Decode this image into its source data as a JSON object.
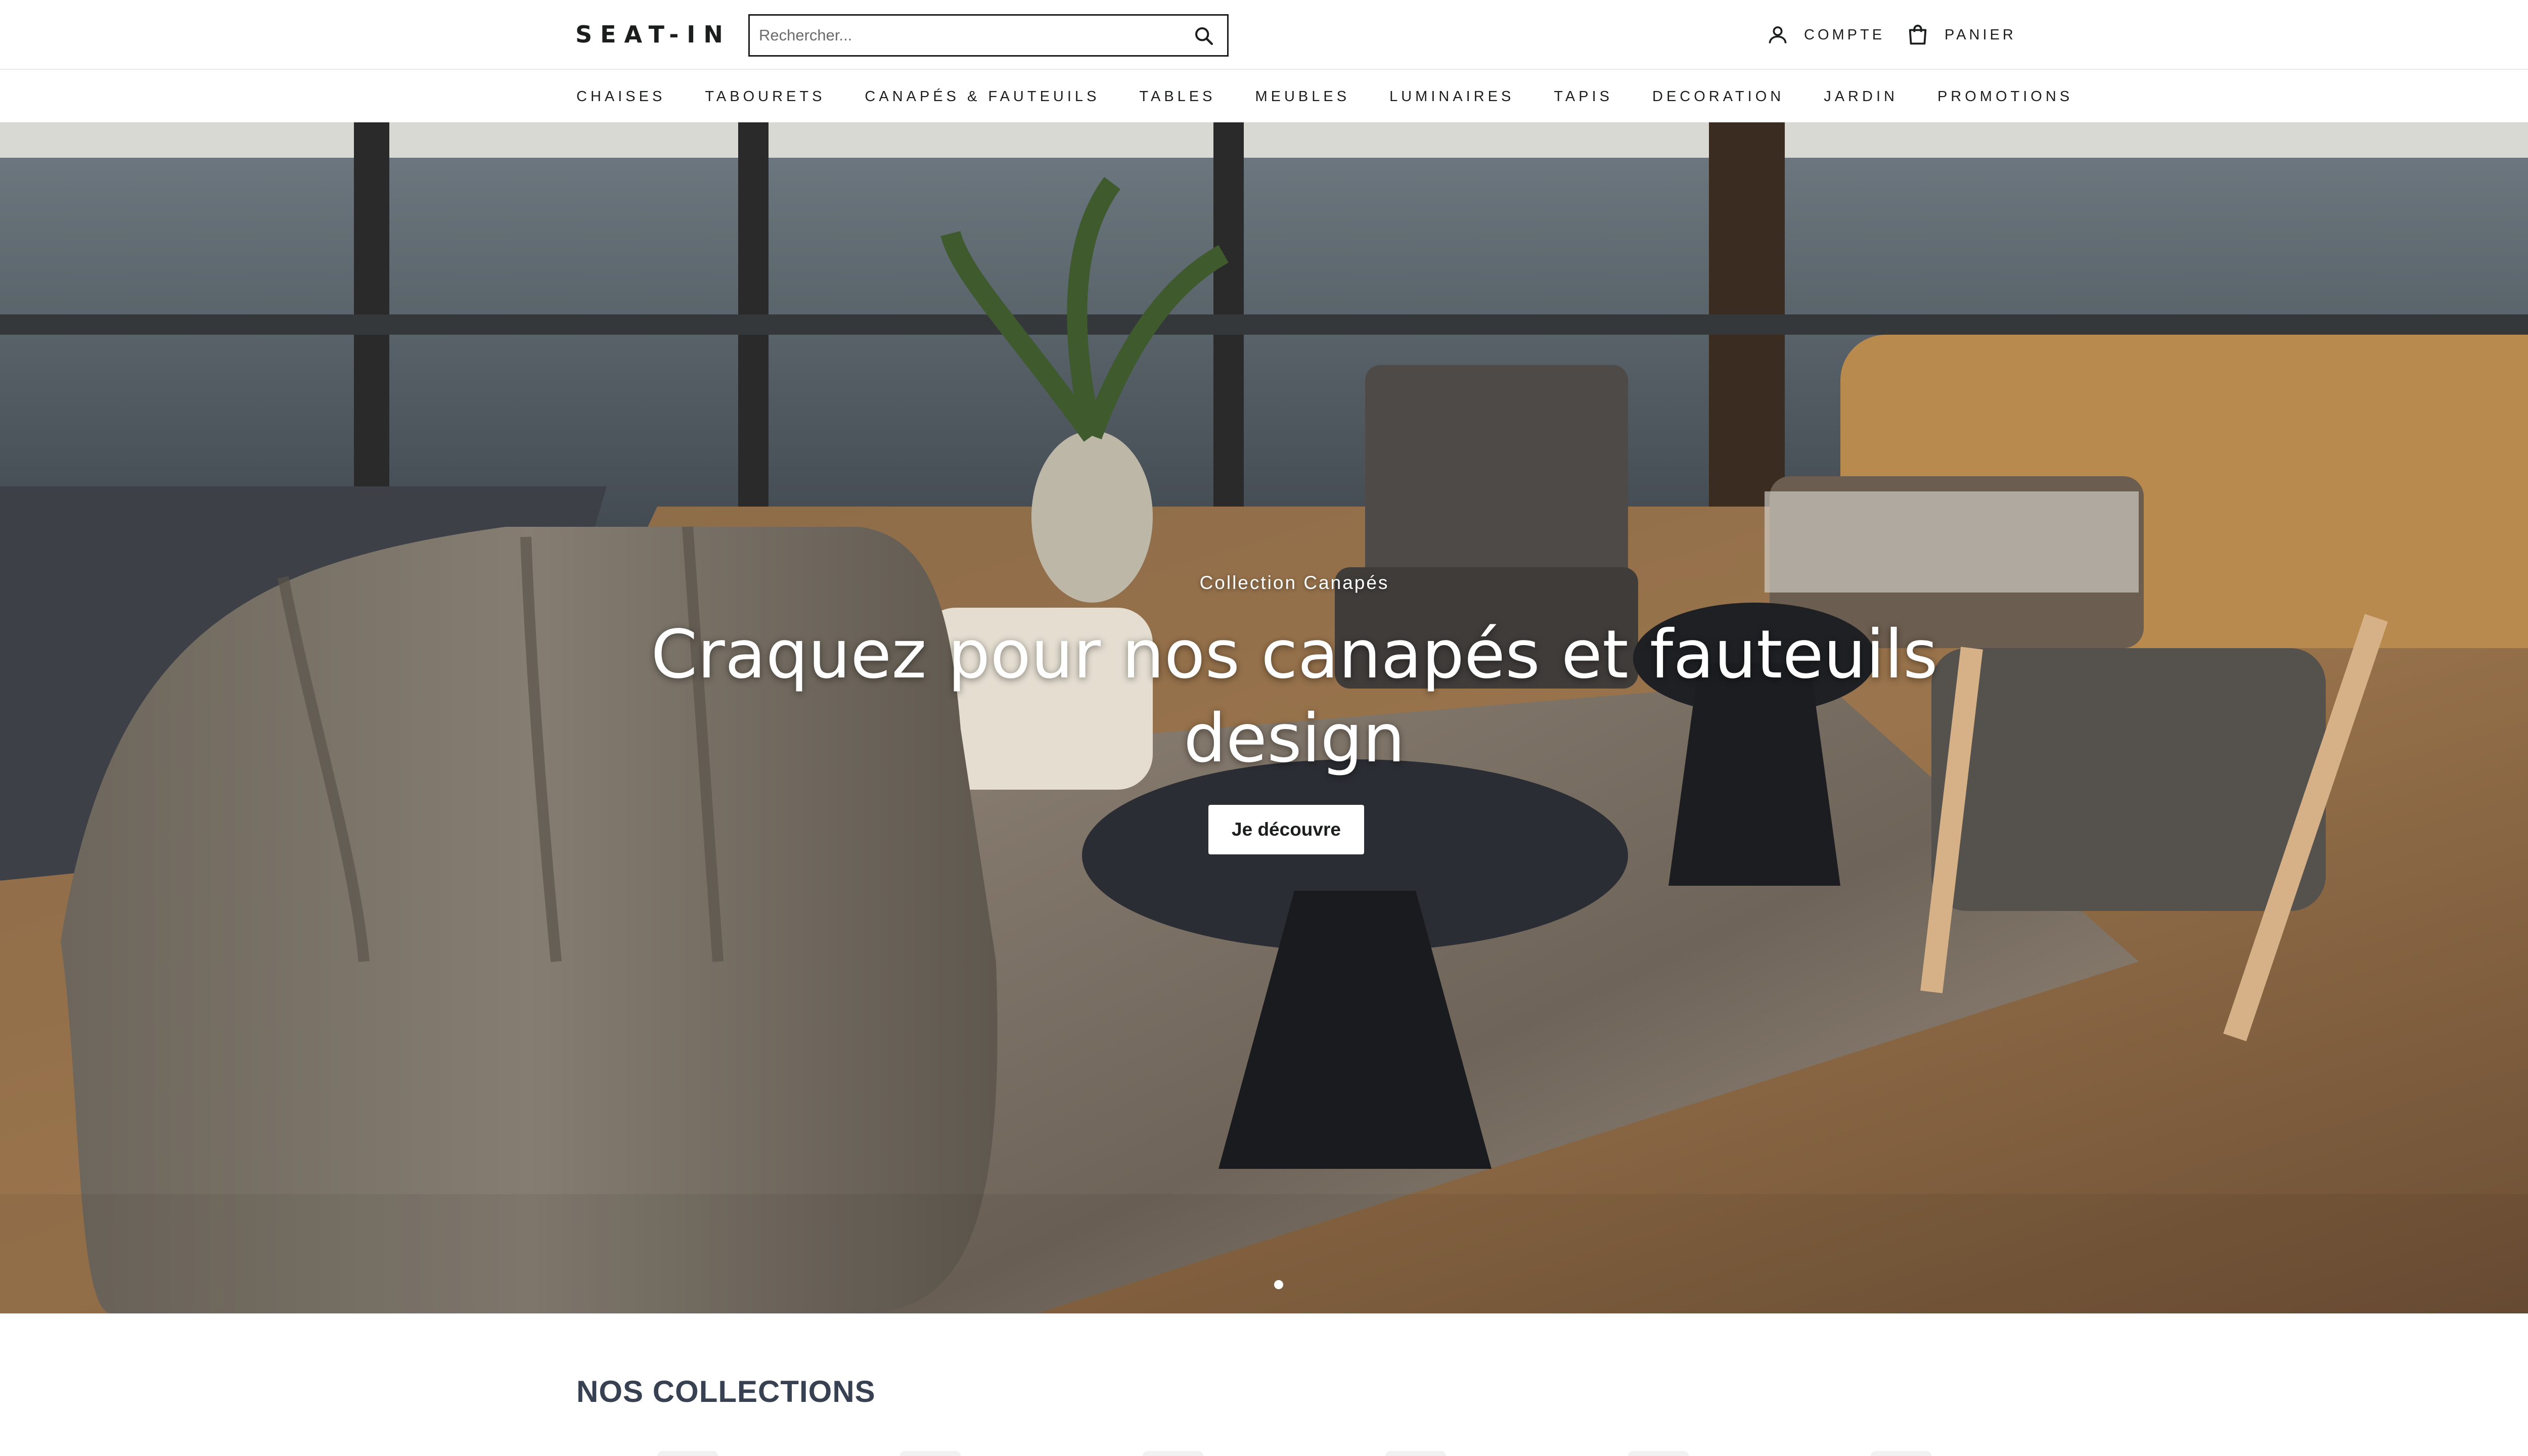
{
  "header": {
    "logo": "SEAT-IN",
    "search": {
      "placeholder": "Rechercher...",
      "value": ""
    },
    "account_label": "COMPTE",
    "cart_label": "PANIER",
    "icons": {
      "search": "search-icon",
      "account": "user-icon",
      "cart": "shopping-bag-icon"
    }
  },
  "nav": {
    "items": [
      {
        "label": "CHAISES"
      },
      {
        "label": "TABOURETS"
      },
      {
        "label": "CANAPÉS & FAUTEUILS"
      },
      {
        "label": "TABLES"
      },
      {
        "label": "MEUBLES"
      },
      {
        "label": "LUMINAIRES"
      },
      {
        "label": "TAPIS"
      },
      {
        "label": "DECORATION"
      },
      {
        "label": "JARDIN"
      },
      {
        "label": "PROMOTIONS"
      }
    ]
  },
  "hero": {
    "subtitle": "Collection Canapés",
    "headline": "Craquez pour nos canapés et fauteuils design",
    "cta_label": "Je découvre",
    "slide_count": 1,
    "active_slide": 1
  },
  "collections": {
    "title": "NOS COLLECTIONS"
  },
  "colors": {
    "text": "#1c1d1d",
    "background": "#ffffff",
    "collections_title": "#374151"
  }
}
